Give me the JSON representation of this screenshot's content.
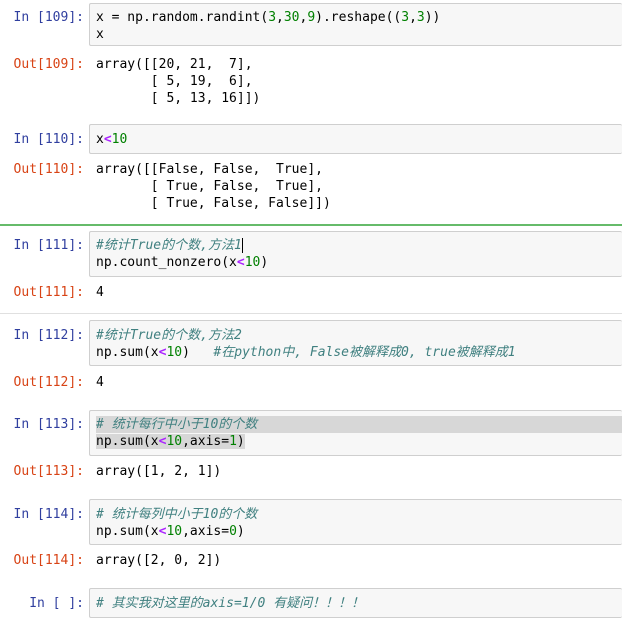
{
  "cells": [
    {
      "in_prompt": "In [109]:",
      "code_lines": [
        "x = np.random.randint(3,30,9).reshape((3,3))",
        "x"
      ],
      "out_prompt": "Out[109]:",
      "output_lines": [
        "array([[20, 21,  7],",
        "       [ 5, 19,  6],",
        "       [ 5, 13, 16]])"
      ]
    },
    {
      "in_prompt": "In [110]:",
      "code_lines": [
        "x<10"
      ],
      "out_prompt": "Out[110]:",
      "output_lines": [
        "array([[False, False,  True],",
        "       [ True, False,  True],",
        "       [ True, False, False]])"
      ]
    },
    {
      "in_prompt": "In [111]:",
      "code_lines": [
        "#统计True的个数,方法1",
        "np.count_nonzero(x<10)"
      ],
      "out_prompt": "Out[111]:",
      "output_lines": [
        "4"
      ]
    },
    {
      "in_prompt": "In [112]:",
      "code_lines": [
        "#统计True的个数,方法2",
        "np.sum(x<10)   #在python中, False被解释成0, true被解释成1"
      ],
      "out_prompt": "Out[112]:",
      "output_lines": [
        "4"
      ]
    },
    {
      "in_prompt": "In [113]:",
      "code_lines": [
        "# 统计每行中小于10的个数",
        "np.sum(x<10,axis=1)"
      ],
      "out_prompt": "Out[113]:",
      "output_lines": [
        "array([1, 2, 1])"
      ]
    },
    {
      "in_prompt": "In [114]:",
      "code_lines": [
        "# 统计每列中小于10的个数",
        "np.sum(x<10,axis=0)"
      ],
      "out_prompt": "Out[114]:",
      "output_lines": [
        "array([2, 0, 2])"
      ]
    },
    {
      "in_prompt": "In [ ]:",
      "code_lines": [
        "# 其实我对这里的axis=1/0 有疑问！！！！"
      ]
    }
  ],
  "colors": {
    "in_prompt": "#303f9f",
    "out_prompt": "#d84315",
    "comment": "#408080",
    "number": "#008000",
    "operator": "#aa22ff",
    "selected_cell_border": "#66bb6a"
  }
}
